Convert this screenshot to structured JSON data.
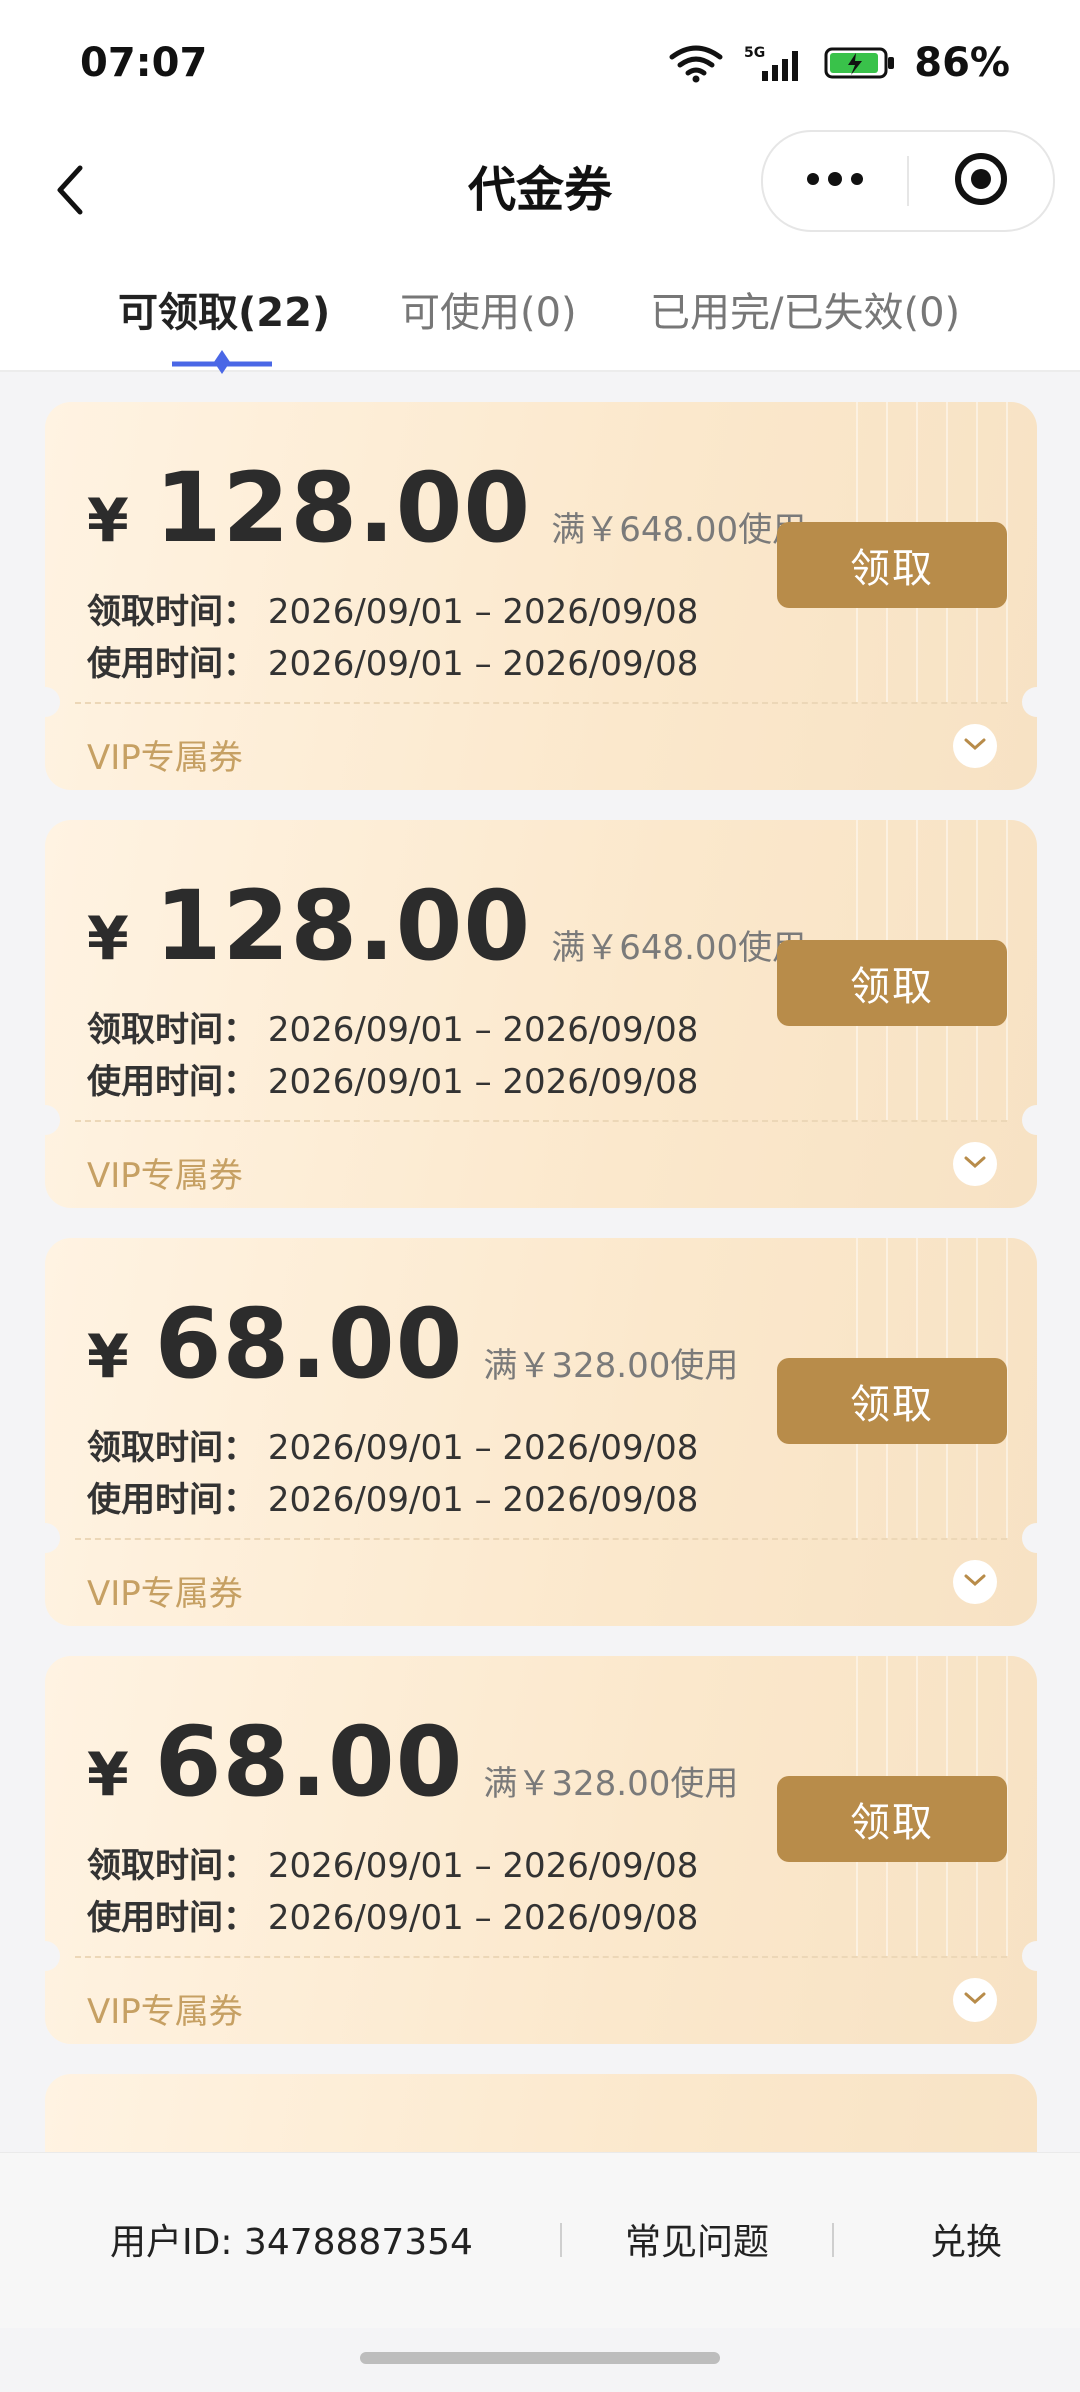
{
  "status_bar": {
    "time": "07:07",
    "network": "5G",
    "battery_percent": "86%"
  },
  "nav": {
    "title": "代金券"
  },
  "tabs": [
    {
      "label": "可领取(22)",
      "active": true
    },
    {
      "label": "可使用(0)",
      "active": false
    },
    {
      "label": "已用完/已失效(0)",
      "active": false
    }
  ],
  "coupons": [
    {
      "currency": "¥",
      "amount": "128.00",
      "threshold": "满￥648.00使用",
      "claim_label": "领取时间：",
      "claim_time": "2026/09/01 – 2026/09/08",
      "use_label": "使用时间：",
      "use_time": "2026/09/01 – 2026/09/08",
      "button": "领取",
      "tag": "VIP专属券"
    },
    {
      "currency": "¥",
      "amount": "128.00",
      "threshold": "满￥648.00使用",
      "claim_label": "领取时间：",
      "claim_time": "2026/09/01 – 2026/09/08",
      "use_label": "使用时间：",
      "use_time": "2026/09/01 – 2026/09/08",
      "button": "领取",
      "tag": "VIP专属券"
    },
    {
      "currency": "¥",
      "amount": "68.00",
      "threshold": "满￥328.00使用",
      "claim_label": "领取时间：",
      "claim_time": "2026/09/01 – 2026/09/08",
      "use_label": "使用时间：",
      "use_time": "2026/09/01 – 2026/09/08",
      "button": "领取",
      "tag": "VIP专属券"
    },
    {
      "currency": "¥",
      "amount": "68.00",
      "threshold": "满￥328.00使用",
      "claim_label": "领取时间：",
      "claim_time": "2026/09/01 – 2026/09/08",
      "use_label": "使用时间：",
      "use_time": "2026/09/01 – 2026/09/08",
      "button": "领取",
      "tag": "VIP专属券"
    }
  ],
  "bottom_bar": {
    "user_id": "用户ID: 3478887354",
    "faq": "常见问题",
    "redeem": "兑换"
  },
  "colors": {
    "accent": "#b88c4a",
    "tab_indicator": "#4a67e6"
  },
  "icons": [
    "back-arrow-icon",
    "more-dots-icon",
    "target-icon",
    "wifi-icon",
    "signal-icon",
    "battery-icon",
    "chevron-down-icon"
  ]
}
